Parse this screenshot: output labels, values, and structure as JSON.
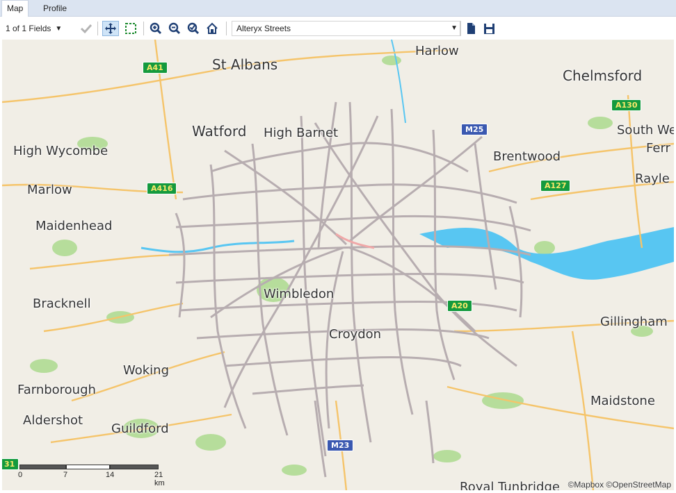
{
  "tabs": [
    {
      "label": "Map",
      "active": true
    },
    {
      "label": "Profile",
      "active": false
    }
  ],
  "toolbar": {
    "fields_label": "1 of 1 Fields",
    "icons": [
      "dropdown-caret",
      "checkmark-icon",
      "pan-icon",
      "select-rectangle-icon",
      "zoom-in-icon",
      "zoom-out-icon",
      "zoom-to-selection-icon",
      "home-icon",
      "copy-icon",
      "save-icon"
    ],
    "layer_select_value": "Alteryx Streets"
  },
  "map": {
    "places": [
      {
        "name": "Harlow"
      },
      {
        "name": "St Albans"
      },
      {
        "name": "Chelmsford"
      },
      {
        "name": "Watford"
      },
      {
        "name": "High Barnet"
      },
      {
        "name": "High Wycombe"
      },
      {
        "name": "Brentwood"
      },
      {
        "name": "South We"
      },
      {
        "name": "Ferr"
      },
      {
        "name": "Rayle"
      },
      {
        "name": "Marlow"
      },
      {
        "name": "Maidenhead"
      },
      {
        "name": "Bracknell"
      },
      {
        "name": "Wimbledon"
      },
      {
        "name": "Croydon"
      },
      {
        "name": "Gillingham"
      },
      {
        "name": "Woking"
      },
      {
        "name": "Farnborough"
      },
      {
        "name": "Maidstone"
      },
      {
        "name": "Aldershot"
      },
      {
        "name": "Guildford"
      },
      {
        "name": "Royal Tunbridge"
      }
    ],
    "road_shields": [
      {
        "label": "A41",
        "kind": "A"
      },
      {
        "label": "A130",
        "kind": "A"
      },
      {
        "label": "M25",
        "kind": "M"
      },
      {
        "label": "A127",
        "kind": "A"
      },
      {
        "label": "A416",
        "kind": "A"
      },
      {
        "label": "A20",
        "kind": "A"
      },
      {
        "label": "M23",
        "kind": "M"
      },
      {
        "label": "31",
        "kind": "A"
      }
    ],
    "scale_labels": [
      "0",
      "7",
      "14",
      "21 km"
    ],
    "attribution": "©Mapbox ©OpenStreetMap",
    "colors": {
      "land": "#f1eee6",
      "water": "#4fc3f0",
      "green": "#a9d98a",
      "roads_major": "#f7c96b",
      "streets_layer": "#b7adb0"
    }
  }
}
